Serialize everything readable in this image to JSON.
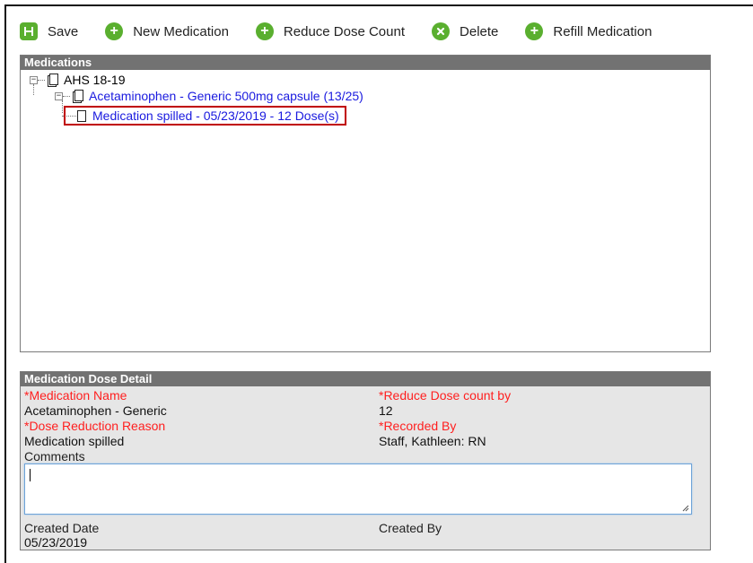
{
  "toolbar": {
    "save": "Save",
    "new_medication": "New Medication",
    "reduce_dose_count": "Reduce Dose Count",
    "delete": "Delete",
    "refill_medication": "Refill Medication"
  },
  "medications_panel": {
    "title": "Medications",
    "tree": {
      "root": "AHS 18-19",
      "medication": "Acetaminophen - Generic 500mg capsule (13/25)",
      "event": "Medication spilled - 05/23/2019 - 12 Dose(s)"
    }
  },
  "detail_panel": {
    "title": "Medication Dose Detail",
    "medication_name_label": "*Medication Name",
    "medication_name_value": "Acetaminophen - Generic",
    "reduce_dose_label": "*Reduce Dose count by",
    "reduce_dose_value": "12",
    "reason_label": "*Dose Reduction Reason",
    "reason_value": "Medication spilled",
    "recorded_by_label": "*Recorded By",
    "recorded_by_value": "Staff, Kathleen: RN",
    "comments_label": "Comments",
    "comments_value": "",
    "created_date_label": "Created Date",
    "created_date_value": "05/23/2019",
    "created_by_label": "Created By",
    "created_by_value": ""
  },
  "colors": {
    "toolbar_icon_green": "#5aaf2f",
    "panel_header": "#727272",
    "required_label": "#ff1f1f",
    "link_blue": "#1a1adf",
    "selection_border": "#c00000"
  }
}
